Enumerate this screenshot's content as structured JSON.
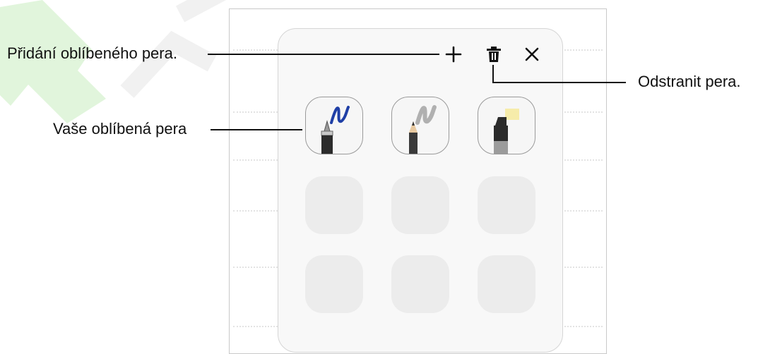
{
  "callouts": {
    "add_pen": "Přidání oblíbeného pera.",
    "favorite_pens": "Vaše oblíbená pera",
    "remove_pens": "Odstranit pera."
  },
  "toolbar": {
    "add_icon": "plus-icon",
    "delete_icon": "trash-icon",
    "close_icon": "close-icon"
  },
  "favorites": {
    "pens": [
      {
        "icon": "fountain-pen-icon",
        "stroke_color": "#1f3fa6"
      },
      {
        "icon": "pencil-icon",
        "stroke_color": "#a8a8a8"
      },
      {
        "icon": "highlighter-icon",
        "stroke_color": "#f6ecaa"
      }
    ],
    "empty_slot_count": 6
  },
  "colors": {
    "panel_bg": "#f8f8f8",
    "slot_bg": "#ececec",
    "watermark": "#cdeec8"
  }
}
